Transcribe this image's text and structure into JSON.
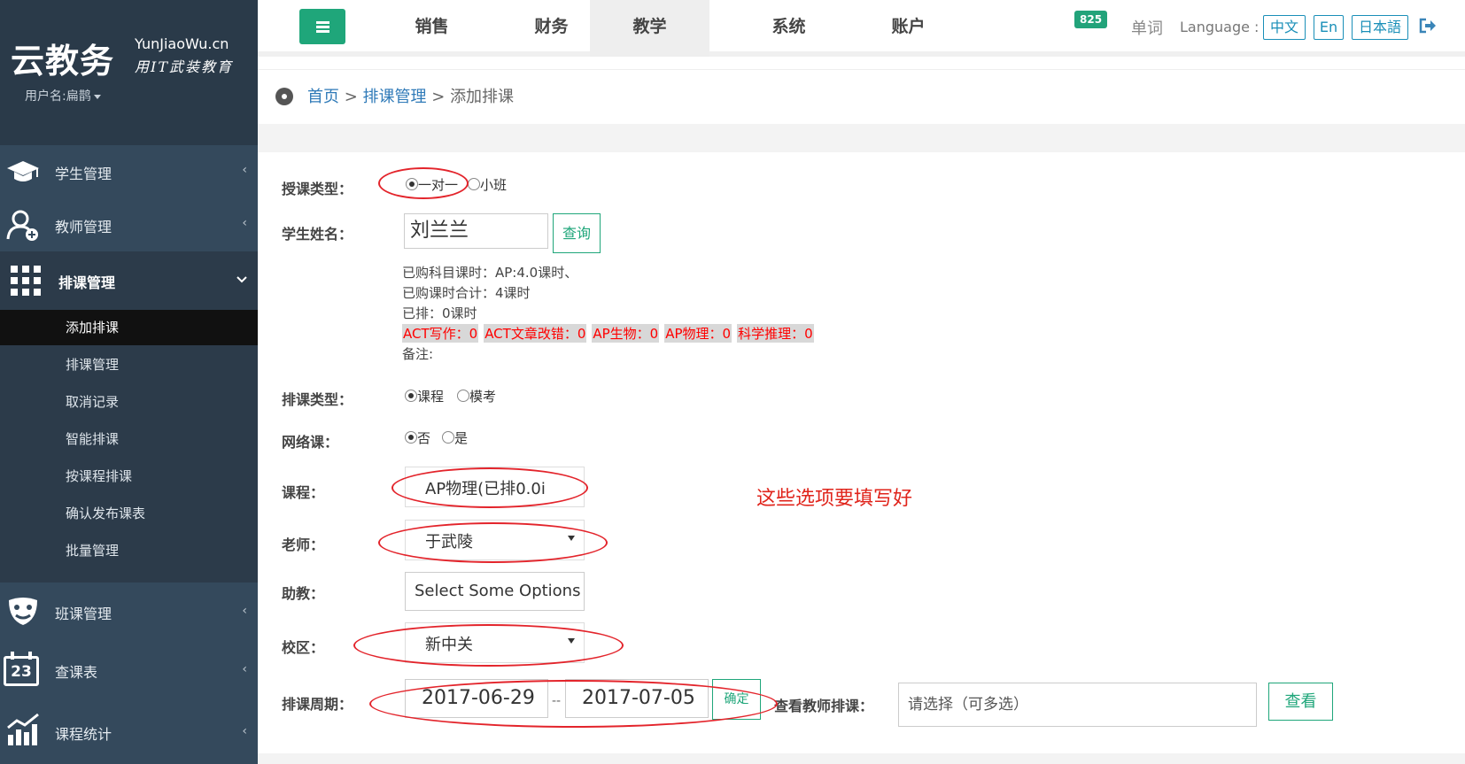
{
  "sidebar": {
    "logo": "云教务",
    "logo_en": "YunJiaoWu.cn",
    "logo_sub": "用IT武装教育",
    "user": "用户名:扁鹊",
    "items": [
      {
        "label": "学生管理"
      },
      {
        "label": "教师管理"
      },
      {
        "label": "排课管理"
      },
      {
        "label": "班课管理"
      },
      {
        "label": "查课表"
      },
      {
        "label": "课程统计"
      }
    ],
    "calendar_day": "23",
    "submenu": [
      {
        "label": "添加排课"
      },
      {
        "label": "排课管理"
      },
      {
        "label": "取消记录"
      },
      {
        "label": "智能排课"
      },
      {
        "label": "按课程排课"
      },
      {
        "label": "确认发布课表"
      },
      {
        "label": "批量管理"
      }
    ]
  },
  "topbar": {
    "tabs": [
      {
        "label": "销售"
      },
      {
        "label": "财务"
      },
      {
        "label": "教学"
      },
      {
        "label": "系统"
      },
      {
        "label": "账户"
      }
    ],
    "badge": "825",
    "word": "单词",
    "language_label": "Language :",
    "languages": [
      "中文",
      "En",
      "日本語"
    ]
  },
  "breadcrumb": {
    "home": "首页",
    "sep1": " > ",
    "section": "排课管理",
    "sep2": " > ",
    "current": "添加排课"
  },
  "form": {
    "teach_type": {
      "label": "授课类型：",
      "options": [
        "一对一",
        "小班"
      ],
      "selected": "一对一"
    },
    "student": {
      "label": "学生姓名：",
      "value": "刘兰兰",
      "query_button": "查询"
    },
    "info_lines": [
      "已购科目课时：AP:4.0课时、",
      "已购课时合计：4课时",
      "已排：0课时"
    ],
    "tags": [
      "ACT写作：0",
      "ACT文章改错：0",
      "AP生物：0",
      "AP物理：0",
      "科学推理：0"
    ],
    "remark": "备注:",
    "schedule_type": {
      "label": "排课类型：",
      "options": [
        "课程",
        "模考"
      ],
      "selected": "课程"
    },
    "online": {
      "label": "网络课：",
      "options": [
        "否",
        "是"
      ],
      "selected": "否"
    },
    "course": {
      "label": "课程：",
      "value": "AP物理(已排0.0i"
    },
    "teacher": {
      "label": "老师：",
      "value": "于武陵"
    },
    "assistant": {
      "label": "助教：",
      "placeholder": "Select Some Options"
    },
    "campus": {
      "label": "校区：",
      "value": "新中关"
    },
    "period": {
      "label": "排课周期：",
      "start": "2017-06-29",
      "sep": "--",
      "end": "2017-07-05",
      "confirm": "确定"
    },
    "teacher_schedule": {
      "label": "查看教师排课：",
      "placeholder": "请选择（可多选）",
      "view_button": "查看"
    }
  },
  "annotation": {
    "note": "这些选项要填写好",
    "color": "#e3242b"
  },
  "colors": {
    "sidebar": "#2c3b4a",
    "accent": "#1fa67a",
    "link": "#2f7ab8"
  }
}
